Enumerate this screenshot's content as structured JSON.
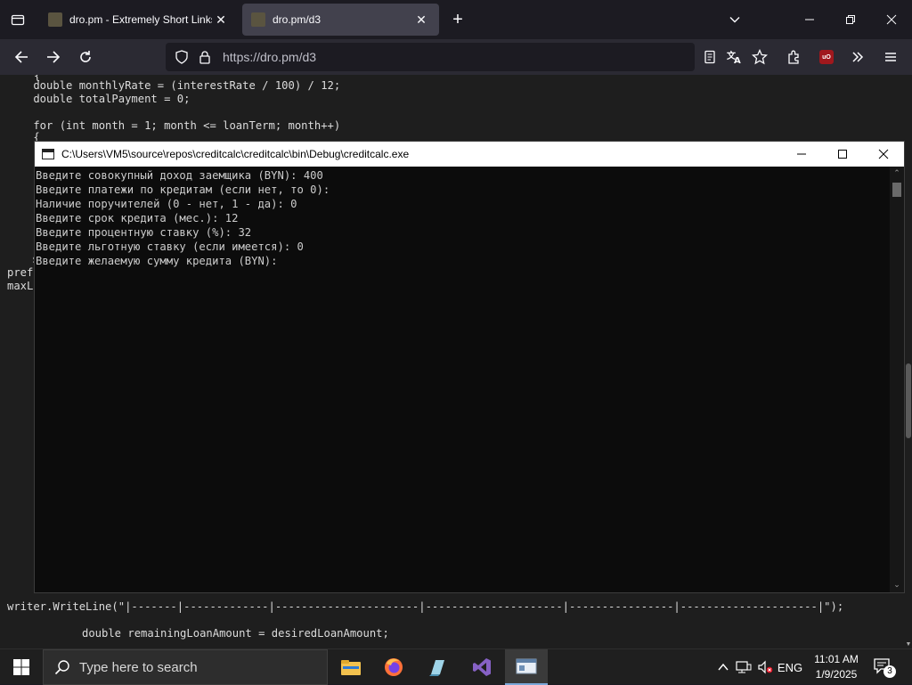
{
  "browser": {
    "tabs": [
      {
        "title": "dro.pm - Extremely Short Links",
        "active": false
      },
      {
        "title": "dro.pm/d3",
        "active": true
      }
    ],
    "url": "https://dro.pm/d3",
    "icons": {
      "tab_list": "tab-list-icon",
      "new_tab": "plus-icon",
      "back": "arrow-left-icon",
      "forward": "arrow-right-icon",
      "reload": "reload-icon",
      "shield": "shield-icon",
      "lock": "lock-icon",
      "reader": "reader-view-icon",
      "translate": "translate-icon",
      "bookmark": "star-icon",
      "extensions": "puzzle-icon",
      "ublock": "ublock-icon",
      "overflow": "chevrons-right-icon",
      "menu": "hamburger-icon"
    },
    "ublock_label": "uO"
  },
  "page_code": {
    "top_lines": [
      "{",
      "    double monthlyRate = (interestRate / 100) / 12;",
      "    double totalPayment = 0;",
      "",
      "    for (int month = 1; month <= loanTerm; month++)",
      "    {"
    ],
    "left_fragments": [
      "s",
      "prefe",
      "maxLo",
      "  ;"
    ],
    "writer_line": "writer.WriteLine(\"|-------|-------------|----------------------|---------------------|----------------|---------------------|\");",
    "remaining_line": "double remainingLoanAmount = desiredLoanAmount;"
  },
  "console": {
    "title": "C:\\Users\\VM5\\source\\repos\\creditcalc\\creditcalc\\bin\\Debug\\creditcalc.exe",
    "lines": [
      "Введите совокупный доход заемщика (BYN): 400",
      "Введите платежи по кредитам (если нет, то 0):",
      "Наличие поручителей (0 - нет, 1 - да): 0",
      "Введите срок кредита (мес.): 12",
      "Введите процентную ставку (%): 32",
      "Введите льготную ставку (если имеется): 0",
      "Введите желаемую сумму кредита (BYN):"
    ]
  },
  "taskbar": {
    "search_placeholder": "Type here to search",
    "apps": [
      "file-explorer-icon",
      "firefox-icon",
      "notepad-icon",
      "visual-studio-icon",
      "console-app-icon"
    ],
    "language": "ENG",
    "time": "11:01 AM",
    "date": "1/9/2025",
    "notification_count": "3"
  }
}
